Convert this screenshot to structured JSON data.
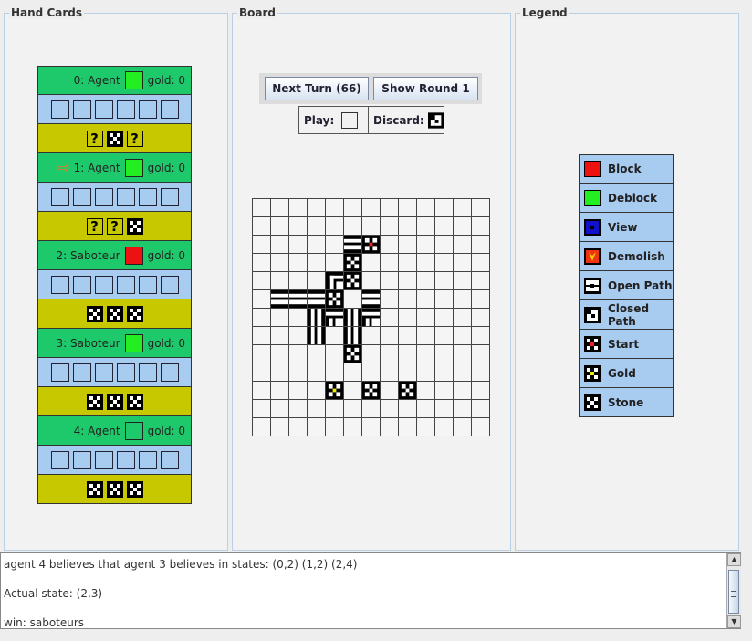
{
  "panels": {
    "hand": "Hand Cards",
    "board": "Board",
    "legend": "Legend"
  },
  "hand": [
    {
      "label": "0: Agent",
      "color": "#22ee22",
      "gold": "gold: 0",
      "arrow": false,
      "cards": [
        "?",
        "stone",
        "?"
      ]
    },
    {
      "label": "1: Agent",
      "color": "#22ee22",
      "gold": "gold: 0",
      "arrow": true,
      "cards": [
        "?",
        "?",
        "stone"
      ]
    },
    {
      "label": "2: Saboteur",
      "color": "#ee1111",
      "gold": "gold: 0",
      "arrow": false,
      "cards": [
        "stone",
        "stone",
        "stone"
      ]
    },
    {
      "label": "3: Saboteur",
      "color": "#22ee22",
      "gold": "gold: 0",
      "arrow": false,
      "cards": [
        "stone",
        "stone",
        "stone"
      ]
    },
    {
      "label": "4: Agent",
      "color": "#1dc96a",
      "gold": "gold: 0",
      "arrow": false,
      "cards": [
        "stone",
        "stone",
        "stone"
      ]
    }
  ],
  "board": {
    "next_turn": "Next Turn (66)",
    "show_round": "Show Round 1",
    "play_label": "Play:",
    "discard_label": "Discard:",
    "grid": {
      "cols": 13,
      "rows": 13
    }
  },
  "legend": [
    {
      "label": "Block",
      "icon": "block-icon",
      "color": "#ee1111"
    },
    {
      "label": "Deblock",
      "icon": "deblock-icon",
      "color": "#22ee22"
    },
    {
      "label": "View",
      "icon": "view-icon",
      "color": "#1111cc"
    },
    {
      "label": "Demolish",
      "icon": "demolish-icon",
      "color": "#ee3311"
    },
    {
      "label": "Open Path",
      "icon": "open-path-icon"
    },
    {
      "label": "Closed Path",
      "icon": "closed-path-icon"
    },
    {
      "label": "Start",
      "icon": "start-icon"
    },
    {
      "label": "Gold",
      "icon": "gold-icon"
    },
    {
      "label": "Stone",
      "icon": "stone-icon"
    }
  ],
  "log": {
    "line1": "agent 4 believes that agent 3 believes in states: (0,2) (1,2) (2,4)",
    "line2": "Actual state: (2,3)",
    "line3": "win: saboteurs"
  }
}
